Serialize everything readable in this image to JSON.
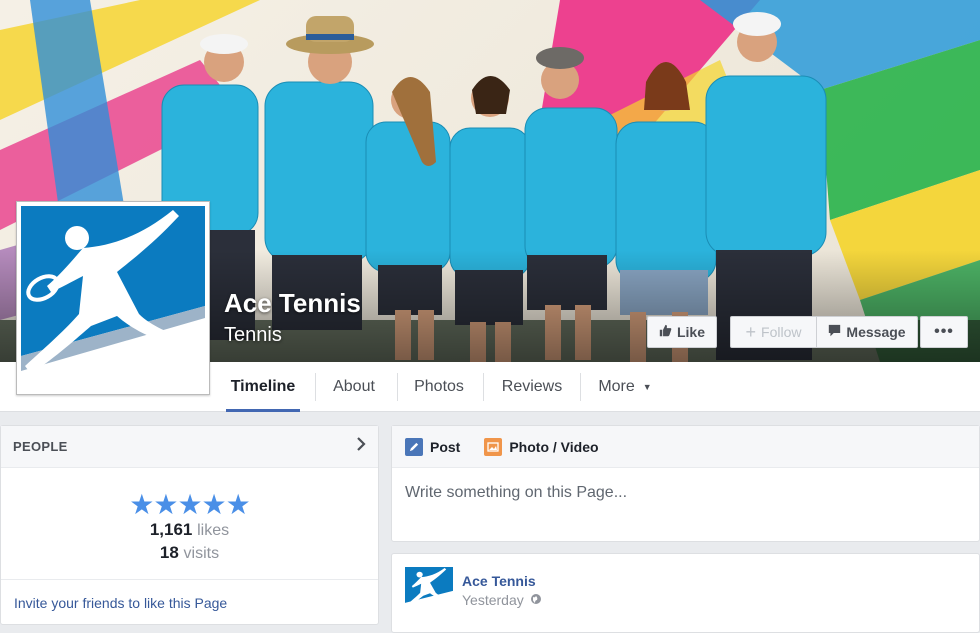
{
  "page": {
    "name": "Ace Tennis",
    "category": "Tennis"
  },
  "actions": {
    "like": "Like",
    "follow": "Follow",
    "message": "Message",
    "more": "•••"
  },
  "tabs": [
    {
      "label": "Timeline",
      "active": true
    },
    {
      "label": "About",
      "active": false
    },
    {
      "label": "Photos",
      "active": false
    },
    {
      "label": "Reviews",
      "active": false
    },
    {
      "label": "More",
      "active": false
    }
  ],
  "people": {
    "title": "PEOPLE",
    "rating_stars": 5,
    "stars_text": "★★★★★",
    "likes_count": "1,161",
    "likes_label": "likes",
    "visits_count": "18",
    "visits_label": "visits",
    "invite": "Invite your friends to like this Page"
  },
  "composer": {
    "post_tab": "Post",
    "photo_tab": "Photo / Video",
    "placeholder": "Write something on this Page..."
  },
  "post": {
    "author": "Ace Tennis",
    "time": "Yesterday"
  },
  "colors": {
    "brand_blue": "#4267b2",
    "link": "#365899",
    "logo_blue": "#0b7bc0",
    "shirt_cyan": "#2bb3dc",
    "star": "#4a8fe7"
  },
  "icons": [
    "thumbs-up-icon",
    "plus-icon",
    "message-icon",
    "chevron-right-icon",
    "pencil-icon",
    "photo-icon",
    "globe-icon",
    "dropdown-arrow-icon"
  ]
}
